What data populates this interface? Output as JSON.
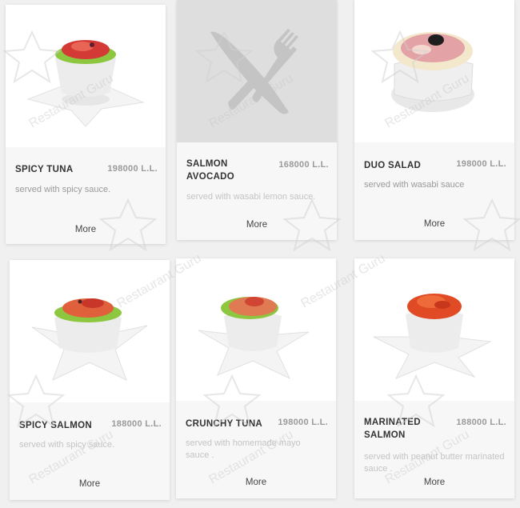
{
  "menu": [
    {
      "name": "SPICY TUNA",
      "price": "198000 L.L.",
      "description": "served with spicy sauce.",
      "more": "More",
      "image": "spicy-tuna-photo"
    },
    {
      "name": "SALMON AVOCADO",
      "price": "168000 L.L.",
      "description": "served with wasabi lemon sauce.",
      "more": "More",
      "image": "cutlery-placeholder-icon"
    },
    {
      "name": "DUO SALAD",
      "price": "198000 L.L.",
      "description": "served with wasabi sauce",
      "more": "More",
      "image": "duo-salad-photo"
    },
    {
      "name": "SPICY SALMON",
      "price": "188000 L.L.",
      "description": "served with spicy sauce.",
      "more": "More",
      "image": "spicy-salmon-photo"
    },
    {
      "name": "CRUNCHY TUNA",
      "price": "198000 L.L.",
      "description": "served with homemade mayo sauce .",
      "more": "More",
      "image": "crunchy-tuna-photo"
    },
    {
      "name": "MARINATED SALMON",
      "price": "188000 L.L.",
      "description": "served with peanut butter marinated sauce .",
      "more": "More",
      "image": "marinated-salmon-photo"
    }
  ],
  "watermark": "Restaurant Guru"
}
